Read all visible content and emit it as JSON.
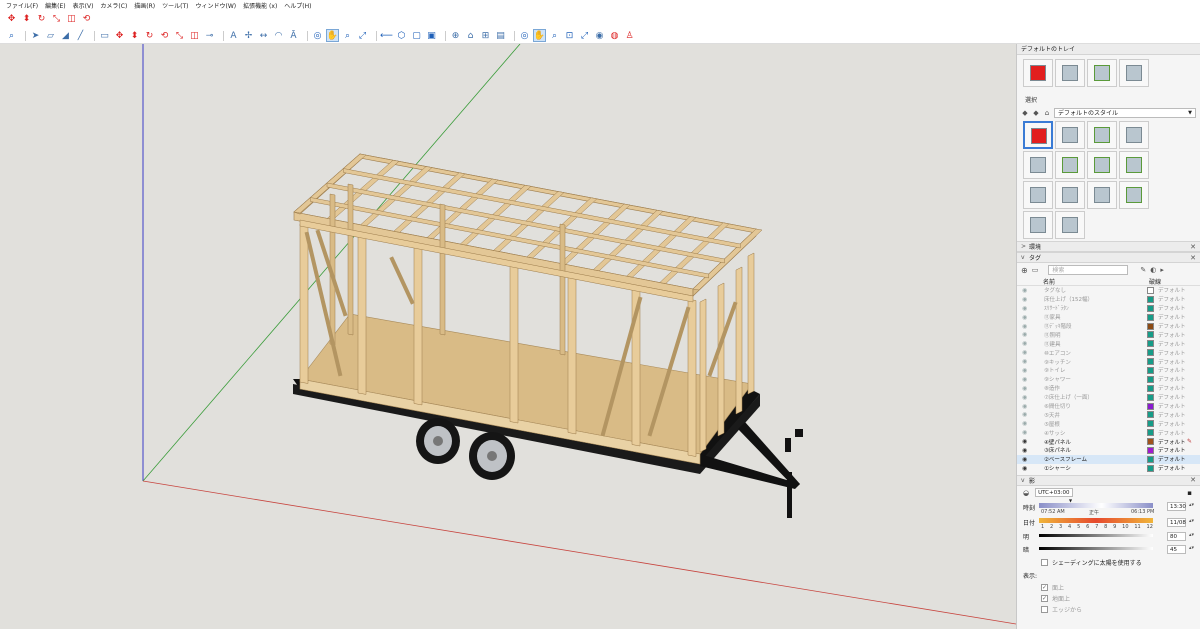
{
  "menu": {
    "items": [
      "ファイル(F)",
      "編集(E)",
      "表示(V)",
      "カメラ(C)",
      "描画(R)",
      "ツール(T)",
      "ウィンドウ(W)",
      "拡張機能 (x)",
      "ヘルプ(H)"
    ]
  },
  "toolbar_icons_row1": [
    "move-icon",
    "push-pull-icon",
    "rotate-icon",
    "scale-icon",
    "offset-icon",
    "follow-me-icon"
  ],
  "toolbar_icons_row2": [
    "zoom-icon",
    "select-icon",
    "eraser-icon",
    "paint-icon",
    "line-icon",
    "rectangle-icon",
    "move-icon",
    "push-pull-icon",
    "rotate-icon",
    "follow-me-icon",
    "scale-icon",
    "offset-icon",
    "tape-icon",
    "text-icon",
    "axes-icon",
    "dimension-icon",
    "protractor-icon",
    "3d-text-icon",
    "orbit-icon",
    "pan-icon",
    "zoom-icon",
    "zoom-extents-icon",
    "previous-icon",
    "iso-icon",
    "top-icon",
    "front-icon",
    "geo-icon",
    "warehouse-icon",
    "extension-warehouse-icon",
    "layout-icon",
    "orbit-icon",
    "pan-icon",
    "zoom-icon",
    "zoom-window-icon",
    "zoom-extents-icon",
    "position-camera-icon",
    "look-around-icon",
    "walk-icon"
  ],
  "colors": {
    "viewport_bg": "#e1e0dc",
    "wood": "#e3c796",
    "wood_dark": "#b99a66",
    "red_axis": "#c7443e",
    "green_axis": "#3a9c3a",
    "blue_axis": "#3b3bc8",
    "accent": "#3a7bd5"
  },
  "tray": {
    "title": "デフォルトのトレイ",
    "styles": {
      "select_tab": "選択",
      "style_name": "デフォルトのスタイル"
    },
    "panels": {
      "environment": "環境",
      "tags": "タグ",
      "shadows": "影"
    },
    "tags": {
      "search_placeholder": "検索",
      "col_name": "名前",
      "col_style": "破線",
      "rows": [
        {
          "name": "タグなし",
          "color": "#ffffff",
          "style": "デフォルト",
          "on": false,
          "hl": false
        },
        {
          "name": "床仕上げ（152幅）",
          "color": "#169c88",
          "style": "デフォルト",
          "on": false,
          "hl": false
        },
        {
          "name": "ｽﾘｻｰﾄﾞﾗﾀﾝ",
          "color": "#169c88",
          "style": "デフォルト",
          "on": false,
          "hl": false
        },
        {
          "name": "⑪家具",
          "color": "#169c88",
          "style": "デフォルト",
          "on": false,
          "hl": false
        },
        {
          "name": "⑪ﾃﾞｯｷ階段",
          "color": "#8b4a14",
          "style": "デフォルト",
          "on": false,
          "hl": false
        },
        {
          "name": "⑪照明",
          "color": "#169c88",
          "style": "デフォルト",
          "on": false,
          "hl": false
        },
        {
          "name": "⑪建具",
          "color": "#169c88",
          "style": "デフォルト",
          "on": false,
          "hl": false
        },
        {
          "name": "⑩エアコン",
          "color": "#169c88",
          "style": "デフォルト",
          "on": false,
          "hl": false
        },
        {
          "name": "⑨キッチン",
          "color": "#169c88",
          "style": "デフォルト",
          "on": false,
          "hl": false
        },
        {
          "name": "⑨トイレ",
          "color": "#169c88",
          "style": "デフォルト",
          "on": false,
          "hl": false
        },
        {
          "name": "⑨シャワー",
          "color": "#169c88",
          "style": "デフォルト",
          "on": false,
          "hl": false
        },
        {
          "name": "⑧造作",
          "color": "#169c88",
          "style": "デフォルト",
          "on": false,
          "hl": false
        },
        {
          "name": "⑦床仕上げ（一面）",
          "color": "#169c88",
          "style": "デフォルト",
          "on": false,
          "hl": false
        },
        {
          "name": "⑥間仕切り",
          "color": "#8a1ad0",
          "style": "デフォルト",
          "on": false,
          "hl": false
        },
        {
          "name": "⑤天井",
          "color": "#169c88",
          "style": "デフォルト",
          "on": false,
          "hl": false
        },
        {
          "name": "⑤屋根",
          "color": "#169c88",
          "style": "デフォルト",
          "on": false,
          "hl": false
        },
        {
          "name": "④サッシ",
          "color": "#169c88",
          "style": "デフォルト",
          "on": false,
          "hl": false
        },
        {
          "name": "④壁パネル",
          "color": "#a0521c",
          "style": "デフォルト",
          "on": true,
          "hl": false
        },
        {
          "name": "③床パネル",
          "color": "#a01ad0",
          "style": "デフォルト",
          "on": true,
          "hl": false
        },
        {
          "name": "②ベースフレーム",
          "color": "#169c88",
          "style": "デフォルト",
          "on": true,
          "hl": true
        },
        {
          "name": "①シャーシ",
          "color": "#169c88",
          "style": "デフォルト",
          "on": true,
          "hl": false
        }
      ]
    },
    "shadows": {
      "timezone": "UTC+03:00",
      "time_label": "時刻",
      "sunrise": "07:52 AM",
      "noon": "正午",
      "sunset": "06:13 PM",
      "time_value": "13:30",
      "date_label": "日付",
      "months": [
        "1",
        "2",
        "3",
        "4",
        "5",
        "6",
        "7",
        "8",
        "9",
        "10",
        "11",
        "12"
      ],
      "date_value": "11/08",
      "light_label": "明",
      "light_value": "80",
      "dark_label": "暗",
      "dark_value": "45",
      "use_sun_label": "シェーディングに太陽を使用する",
      "display_label": "表示:",
      "on_faces": "面上",
      "on_ground": "地面上",
      "from_edges": "エッジから"
    }
  }
}
